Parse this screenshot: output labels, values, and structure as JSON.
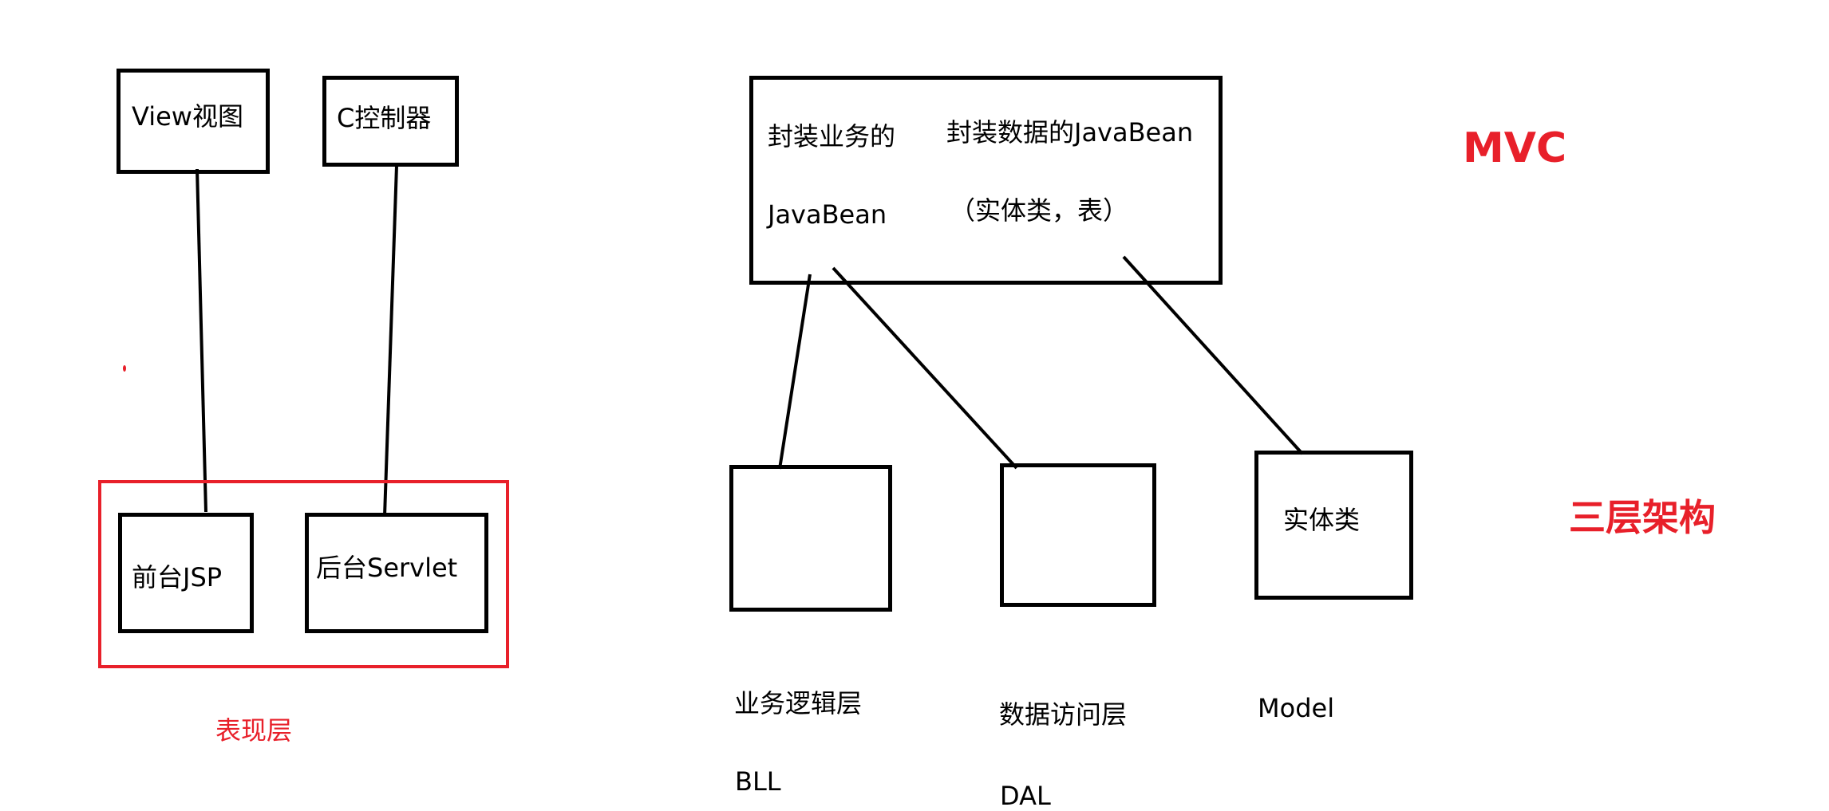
{
  "mvc": {
    "view": "View视图",
    "controller": "C控制器",
    "model_box_line1": "封装业务的",
    "model_box_line2": "JavaBean",
    "model_box_data_line1": "封装数据的JavaBean",
    "model_box_data_line2": "（实体类，表）",
    "title": "MVC"
  },
  "presentation": {
    "frontend": "前台JSP",
    "backend": "后台Servlet",
    "label": "表现层"
  },
  "three_tier": {
    "bll_name": "业务逻辑层",
    "bll_abbr": "BLL",
    "dal_name": "数据访问层",
    "dal_abbr": "DAL",
    "entity": "实体类",
    "model": "Model",
    "title": "三层架构"
  },
  "colors": {
    "accent": "#e8202a",
    "line": "#000000"
  }
}
